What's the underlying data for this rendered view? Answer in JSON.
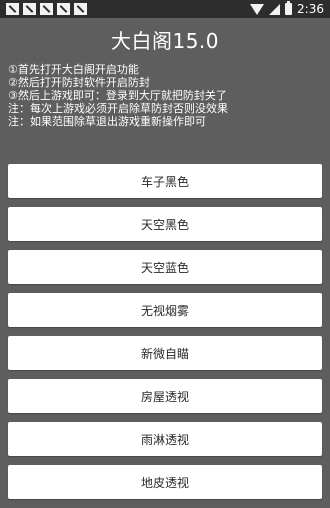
{
  "status_bar": {
    "notification_icons": [
      "notification-icon",
      "notification-icon",
      "notification-icon",
      "notification-icon",
      "notification-icon"
    ],
    "time": "2:36"
  },
  "app": {
    "title": "大白阁15.0",
    "instructions": [
      "①首先打开大白阁开启功能",
      "②然后打开防封软件开启防封",
      "③然后上游戏即可：登录到大厅就把防封关了",
      "注：每次上游戏必须开启除草防封否则没效果",
      "注：如果范围除草退出游戏重新操作即可"
    ]
  },
  "buttons": [
    "车子黑色",
    "天空黑色",
    "天空蓝色",
    "无视烟雾",
    "新微自瞄",
    "房屋透视",
    "雨淋透视",
    "地皮透视"
  ]
}
